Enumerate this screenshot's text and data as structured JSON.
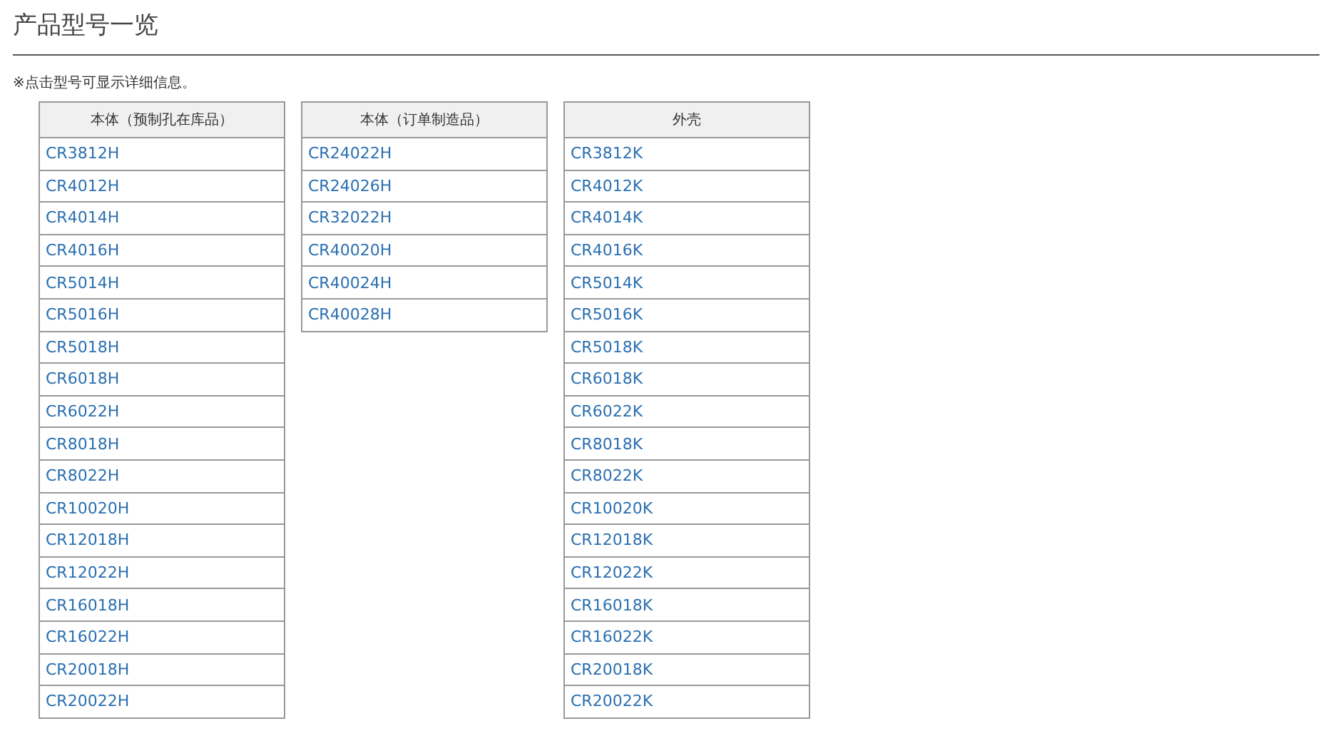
{
  "page": {
    "title": "产品型号一览",
    "note": "※点击型号可显示详细信息。"
  },
  "tables": [
    {
      "heading": "本体（预制孔在库品）",
      "rows": [
        "CR3812H",
        "CR4012H",
        "CR4014H",
        "CR4016H",
        "CR5014H",
        "CR5016H",
        "CR5018H",
        "CR6018H",
        "CR6022H",
        "CR8018H",
        "CR8022H",
        "CR10020H",
        "CR12018H",
        "CR12022H",
        "CR16018H",
        "CR16022H",
        "CR20018H",
        "CR20022H"
      ]
    },
    {
      "heading": "本体（订单制造品）",
      "rows": [
        "CR24022H",
        "CR24026H",
        "CR32022H",
        "CR40020H",
        "CR40024H",
        "CR40028H"
      ]
    },
    {
      "heading": "外壳",
      "rows": [
        "CR3812K",
        "CR4012K",
        "CR4014K",
        "CR4016K",
        "CR5014K",
        "CR5016K",
        "CR5018K",
        "CR6018K",
        "CR6022K",
        "CR8018K",
        "CR8022K",
        "CR10020K",
        "CR12018K",
        "CR12022K",
        "CR16018K",
        "CR16022K",
        "CR20018K",
        "CR20022K"
      ]
    }
  ]
}
